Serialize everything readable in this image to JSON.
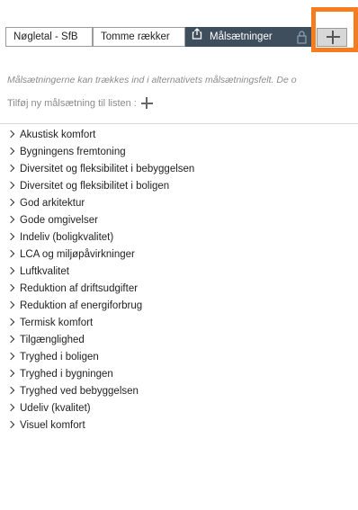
{
  "tabs": [
    {
      "label": "Nøgletal - SfB"
    },
    {
      "label": "Tomme rækker"
    },
    {
      "label": "Målsætninger",
      "icon": "share-icon",
      "lock_icon": "lock-icon",
      "active": true
    }
  ],
  "add_tab_icon": "plus-icon",
  "hint": "Målsætningerne kan trækkes ind i alternativets målsætningsfelt. De o",
  "add_goal_label": "Tilføj ny målsætning til listen :",
  "goals": [
    "Akustisk komfort",
    "Bygningens fremtoning",
    "Diversitet og fleksibilitet i bebyggelsen",
    "Diversitet og fleksibilitet i boligen",
    "God arkitektur",
    "Gode omgivelser",
    "Indeliv (boligkvalitet)",
    "LCA og miljøpåvirkninger",
    "Luftkvalitet",
    "Reduktion af driftsudgifter",
    "Reduktion af energiforbrug",
    "Termisk komfort",
    "Tilgænglighed",
    "Tryghed i boligen",
    "Tryghed i bygningen",
    "Tryghed ved bebyggelsen",
    "Udeliv (kvalitet)",
    "Visuel komfort"
  ],
  "colors": {
    "active_tab": "#3f4e5c",
    "highlight": "#f57c1f"
  }
}
